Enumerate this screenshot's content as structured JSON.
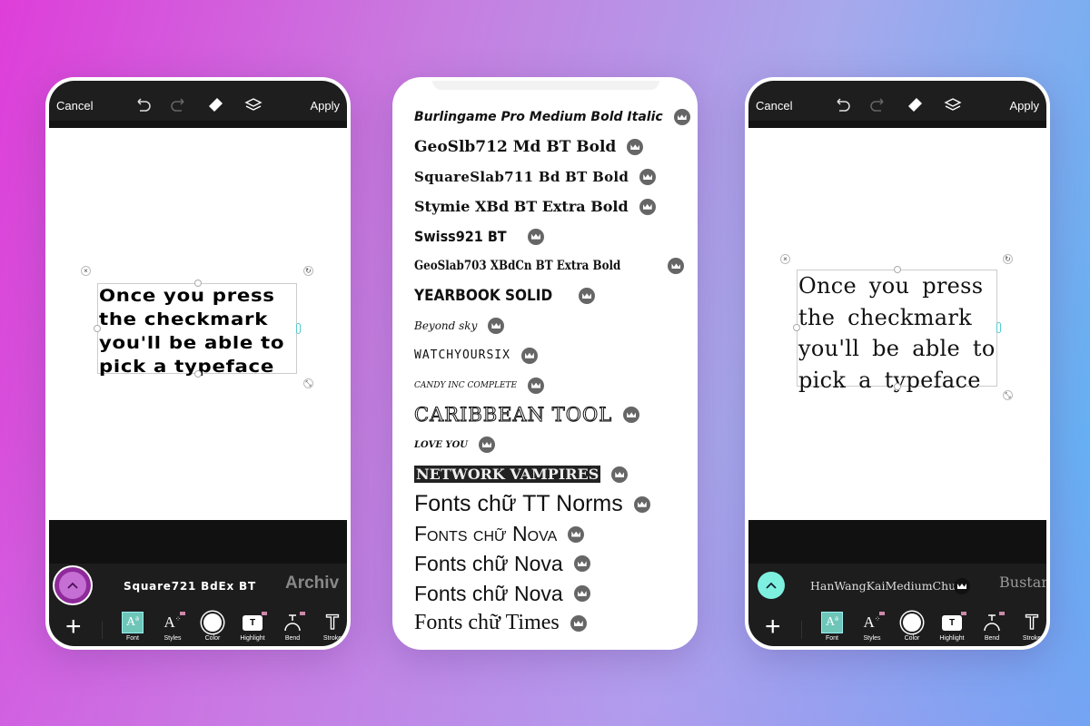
{
  "editor_left": {
    "cancel": "Cancel",
    "apply": "Apply",
    "text_lines": [
      "Once you press",
      "the checkmark",
      "you'll be able to",
      "pick a typeface"
    ],
    "fonts": [
      "Square721 BdEx BT",
      "Archiv"
    ],
    "fab_color": "#8e2a9a"
  },
  "editor_right": {
    "cancel": "Cancel",
    "apply": "Apply",
    "text_lines": [
      "Once you press",
      "the checkmark",
      "you'll be able to",
      "pick a typeface"
    ],
    "fonts": [
      "HanWangKaiMediumChuIn",
      "Bustan"
    ],
    "fab_color": "#7ef0e0"
  },
  "tools": [
    {
      "label": "Font",
      "icon": "font-icon"
    },
    {
      "label": "Styles",
      "icon": "styles-icon"
    },
    {
      "label": "Color",
      "icon": "color-icon"
    },
    {
      "label": "Highlight",
      "icon": "highlight-icon"
    },
    {
      "label": "Bend",
      "icon": "bend-icon"
    },
    {
      "label": "Stroke",
      "icon": "stroke-icon"
    }
  ],
  "font_list": [
    "Burlingame Pro Medium Bold Italic",
    "GeoSlb712 Md BT Bold",
    "SquareSlab711 Bd BT Bold",
    "Stymie XBd BT Extra Bold",
    "Swiss921 BT",
    "GeoSlab703 XBdCn BT Extra Bold",
    "YEARBOOK SOLID",
    "Beyond sky",
    "WATCHYOURSIX",
    "CANDY INC COMPLETE",
    "CARIBBEAN TOOL",
    "LOVE YOU",
    "NETWORK VAMPIRES",
    "Fonts chữ TT Norms",
    "Fonts chữ Nova",
    "Fonts chữ Nova",
    "Fonts chữ Nova",
    "Fonts chữ Times"
  ],
  "premium_icon": "crown-icon"
}
